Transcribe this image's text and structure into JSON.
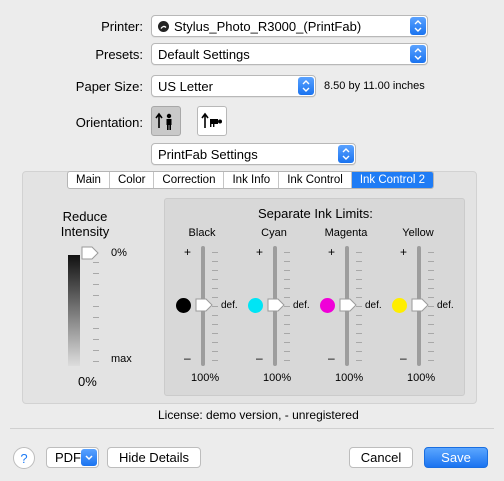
{
  "printer": {
    "label": "Printer:",
    "value": "Stylus_Photo_R3000_(PrintFab)"
  },
  "presets": {
    "label": "Presets:",
    "value": "Default Settings"
  },
  "paper": {
    "label": "Paper Size:",
    "value": "US Letter",
    "dimensions": "8.50 by 11.00 inches"
  },
  "orientation": {
    "label": "Orientation:",
    "selected": "portrait"
  },
  "panel_select": {
    "value": "PrintFab Settings"
  },
  "tabs": [
    "Main",
    "Color",
    "Correction",
    "Ink Info",
    "Ink Control",
    "Ink Control 2"
  ],
  "active_tab": "Ink Control 2",
  "reduce": {
    "title_line1": "Reduce",
    "title_line2": "Intensity",
    "top": "0%",
    "bottom": "max",
    "value": "0%"
  },
  "ink_limits": {
    "title": "Separate Ink Limits:",
    "plus": "+",
    "minus": "–",
    "def": "def.",
    "channels": [
      {
        "name": "Black",
        "color": "#000000",
        "value": "100%"
      },
      {
        "name": "Cyan",
        "color": "#00e5f5",
        "value": "100%"
      },
      {
        "name": "Magenta",
        "color": "#f000d8",
        "value": "100%"
      },
      {
        "name": "Yellow",
        "color": "#ffee00",
        "value": "100%"
      }
    ]
  },
  "license": "License: demo version,  - unregistered",
  "footer": {
    "help": "?",
    "pdf": "PDF",
    "hide_details": "Hide Details",
    "cancel": "Cancel",
    "save": "Save"
  },
  "colors": {
    "accent": "#1f7cf5"
  }
}
